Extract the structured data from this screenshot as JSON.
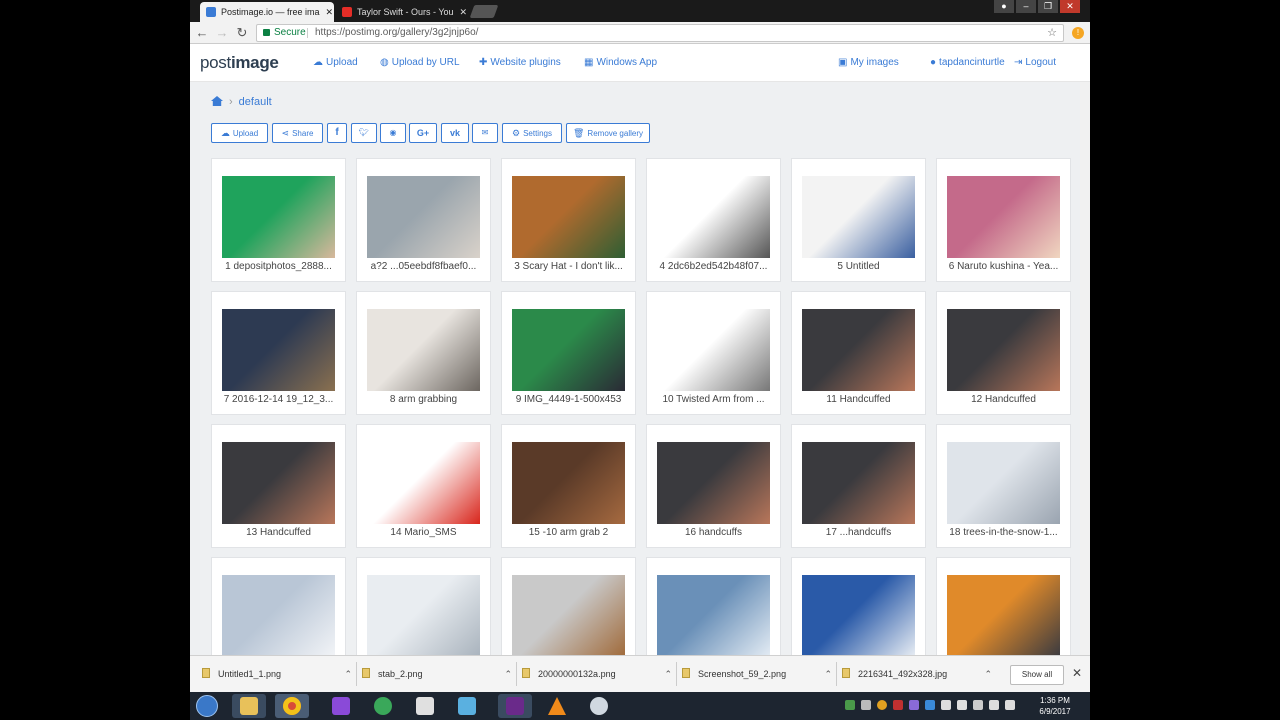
{
  "browser": {
    "tabs": [
      {
        "title": "Postimage.io — free ima",
        "favicon_color": "#3a7bd5"
      },
      {
        "title": "Taylor Swift - Ours - You",
        "favicon_color": "#e52d27"
      }
    ],
    "secure_label": "Secure",
    "url": "https://postimg.org/gallery/3g2jnjp6o/"
  },
  "site": {
    "logo": {
      "part1": "post",
      "part2": "image"
    },
    "nav_left": [
      {
        "label": "Upload",
        "icon": "cloud-upload-icon"
      },
      {
        "label": "Upload by URL",
        "icon": "globe-icon"
      },
      {
        "label": "Website plugins",
        "icon": "puzzle-icon"
      },
      {
        "label": "Windows App",
        "icon": "windows-icon"
      }
    ],
    "nav_right": [
      {
        "label": "My images",
        "icon": "image-icon"
      },
      {
        "label": "tapdancinturtle",
        "icon": "user-icon"
      },
      {
        "label": "Logout",
        "icon": "logout-icon"
      }
    ]
  },
  "gallery": {
    "breadcrumb": {
      "current": "default"
    },
    "actions": {
      "upload": "Upload",
      "share": "Share",
      "facebook": "f",
      "googleplus": "G+",
      "vk": "vk",
      "settings": "Settings",
      "remove": "Remove gallery"
    },
    "items": [
      {
        "caption": "1 depositphotos_2888...",
        "colors": [
          "#1fa35c",
          "#d8b89c"
        ]
      },
      {
        "caption": "a?2 ...05eebdf8fbaef0...",
        "colors": [
          "#9aa5ad",
          "#d9d2ca"
        ]
      },
      {
        "caption": "3 Scary Hat - I don't lik...",
        "colors": [
          "#b06a2e",
          "#2e5e33"
        ]
      },
      {
        "caption": "4 2dc6b2ed542b48f07...",
        "colors": [
          "#ffffff",
          "#555555"
        ]
      },
      {
        "caption": "5 Untitled",
        "colors": [
          "#f3f3f3",
          "#3a5fa0"
        ]
      },
      {
        "caption": "6 Naruto kushina - Yea...",
        "colors": [
          "#c46a8a",
          "#f0d6c0"
        ]
      },
      {
        "caption": "7 2016-12-14 19_12_3...",
        "colors": [
          "#2d3a52",
          "#8a7050"
        ]
      },
      {
        "caption": "8 arm grabbing",
        "colors": [
          "#e8e4df",
          "#6c6660"
        ]
      },
      {
        "caption": "9 IMG_4449-1-500x453",
        "colors": [
          "#2b8a4a",
          "#2a2a35"
        ]
      },
      {
        "caption": "10 Twisted Arm from ...",
        "colors": [
          "#ffffff",
          "#777777"
        ]
      },
      {
        "caption": "11 Handcuffed",
        "colors": [
          "#3a3a3e",
          "#b8765a"
        ]
      },
      {
        "caption": "12 Handcuffed",
        "colors": [
          "#3a3a3e",
          "#b8765a"
        ]
      },
      {
        "caption": "13 Handcuffed",
        "colors": [
          "#3a3a3e",
          "#b8765a"
        ]
      },
      {
        "caption": "14 Mario_SMS",
        "colors": [
          "#ffffff",
          "#d8261c"
        ]
      },
      {
        "caption": "15 -10 arm grab 2",
        "colors": [
          "#5a3a28",
          "#a66a40"
        ]
      },
      {
        "caption": "16 handcuffs",
        "colors": [
          "#3a3a3e",
          "#b8765a"
        ]
      },
      {
        "caption": "17 ...handcuffs",
        "colors": [
          "#3a3a3e",
          "#b8765a"
        ]
      },
      {
        "caption": "18 trees-in-the-snow-1...",
        "colors": [
          "#dfe4ea",
          "#9aa4b0"
        ]
      },
      {
        "caption": "",
        "colors": [
          "#b9c6d6",
          "#f2f4f7"
        ]
      },
      {
        "caption": "",
        "colors": [
          "#e9edf1",
          "#a9b3bd"
        ]
      },
      {
        "caption": "",
        "colors": [
          "#c9c9c9",
          "#a06a3a"
        ]
      },
      {
        "caption": "",
        "colors": [
          "#6a90b8",
          "#e4ecf4"
        ]
      },
      {
        "caption": "",
        "colors": [
          "#2a5aa8",
          "#e9eef4"
        ]
      },
      {
        "caption": "",
        "colors": [
          "#e08a2a",
          "#3a3a40"
        ]
      }
    ]
  },
  "downloads": {
    "items": [
      "Untitled1_1.png",
      "stab_2.png",
      "20000000132a.png",
      "Screenshot_59_2.png",
      "2216341_492x328.jpg"
    ],
    "show_all": "Show all"
  },
  "taskbar": {
    "time": "1:36 PM",
    "date": "6/9/2017"
  }
}
